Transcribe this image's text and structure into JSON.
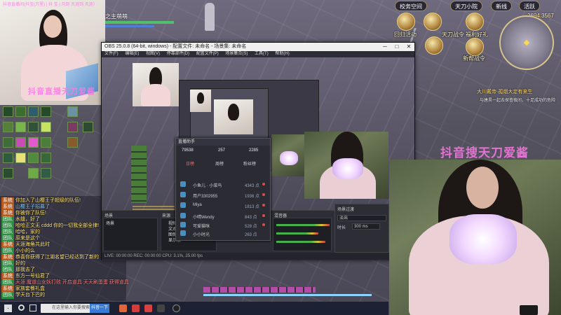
{
  "stream_banner": "抖音直播间(抖宝(万里) | 抖 宝 | 月到 天涯到 天涯）",
  "game": {
    "character_label": "之主萌萌",
    "top_bar": [
      "校务空间",
      "天刀小院",
      "新线",
      "活跃"
    ],
    "gold": "2694.3567",
    "menu_buttons": [
      "回归活动",
      "天刀战令",
      "福利好礼",
      "百家盒",
      "新帮战令"
    ],
    "quest_title": "大川戴帝·孤烟大定有来生",
    "quest_desc": "与唐昊一起去探查夜间，十足成功的危险",
    "watermark_right": "抖音搜天刀爱酱"
  },
  "streamer_cam": {
    "watermark": "抖音直播天刀爱酱"
  },
  "chat": [
    {
      "tag": "系统",
      "text": "你加入了山樱王子超级的队伍!",
      "type": "sys"
    },
    {
      "tag": "系统",
      "text": "山樱王子招募了",
      "type": "sys"
    },
    {
      "tag": "系统",
      "text": "你被你了队伍!",
      "type": "sys"
    },
    {
      "tag": "团队",
      "text": "水缝，好了",
      "type": ""
    },
    {
      "tag": "团队",
      "text": "哈哈正文无 cddd 你的一切我全部全律!",
      "type": ""
    },
    {
      "tag": "团队",
      "text": "哈哈，家的",
      "type": ""
    },
    {
      "tag": "团队",
      "text": "原来是这个",
      "type": ""
    },
    {
      "tag": "系统",
      "text": "天涯海角共此时",
      "type": "sys"
    },
    {
      "tag": "团队",
      "text": "小小的么",
      "type": ""
    },
    {
      "tag": "系统",
      "text": "恭喜你获得了江湖名望已经达到了新的",
      "type": "sys"
    },
    {
      "tag": "团队",
      "text": "好的",
      "type": ""
    },
    {
      "tag": "团队",
      "text": "那我去了",
      "type": ""
    },
    {
      "tag": "系统",
      "text": "东方一号仙君了",
      "type": "sys"
    },
    {
      "tag": "团队",
      "text": "天涯 魔道山女妖打败 开启道具 天天刷蛋蛋 获得道具",
      "type": "red"
    },
    {
      "tag": "系统",
      "text": "家族套餐礼盒",
      "type": "sys"
    },
    {
      "tag": "团队",
      "text": "学天台下巴的",
      "type": ""
    }
  ],
  "obs": {
    "title": "OBS 25.0.8 (64-bit, windows) - 配置文件: 未命名 - 场景集: 未命名",
    "menu": [
      "文件(F)",
      "编辑(E)",
      "视图(V)",
      "停靠部件(D)",
      "配置文件(P)",
      "场景集合(S)",
      "工具(T)",
      "帮助(H)"
    ],
    "docks": {
      "scenes": "场景",
      "sources": "来源",
      "mixer": "混音器",
      "transitions": "场景过渡",
      "controls": "控件"
    },
    "scene_items": [
      "场景"
    ],
    "source_items": [
      "视频1",
      "文本",
      "图像",
      "显示器"
    ],
    "transition_name": "淡出",
    "transition_duration_label": "时长",
    "transition_duration": "300 ms",
    "status": "LIVE: 00:00:00   REC: 00:00:00   CPU: 3.1%, 25.00 fps"
  },
  "dialog": {
    "title": "直播助手",
    "stats": [
      "79538",
      "257",
      "2285"
    ],
    "tabs": [
      "日榜",
      "周榜",
      "粉丝榜"
    ],
    "rows": [
      {
        "name": "小鱼儿 · 小菜鸟",
        "value": "4343 点"
      },
      {
        "name": "用户3302955",
        "value": "1936 点"
      },
      {
        "name": "Miya",
        "value": "1813 点"
      },
      {
        "name": "小晴Wendy",
        "value": "843 点"
      },
      {
        "name": "可爱猫咪",
        "value": "528 点"
      },
      {
        "name": "小小时光",
        "value": "263 点"
      },
      {
        "name": "Q7CA6...",
        "value": "216 点"
      }
    ]
  },
  "taskbar": {
    "search_placeholder": "在这里输入你要搜索的内容",
    "pinned_label": "抖音一下"
  },
  "colors": {
    "accent_pink": "#ff78e6",
    "chat_yellow": "#ffe46d",
    "obs_bg": "#26272e"
  }
}
